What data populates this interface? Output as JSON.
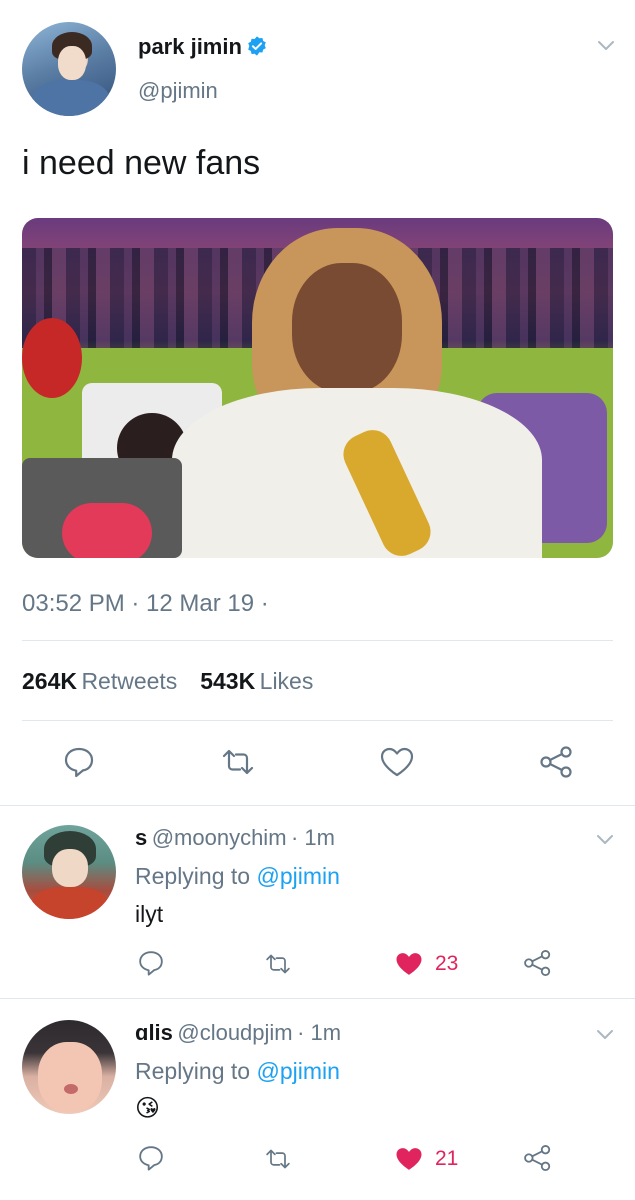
{
  "tweet": {
    "display_name": "park jimin",
    "handle": "@pjimin",
    "text": "i need new fans",
    "timestamp": "03:52 PM · 12 Mar 19 ·",
    "retweets_count": "264K",
    "retweets_label": "Retweets",
    "likes_count": "543K",
    "likes_label": "Likes"
  },
  "actions": {
    "icons": [
      "reply-icon",
      "retweet-icon",
      "like-icon",
      "share-icon"
    ]
  },
  "replies": [
    {
      "display_name": "s",
      "handle": "@moonychim",
      "time": "· 1m",
      "replying_prefix": "Replying to",
      "replying_to": "@pjimin",
      "text": "ilyt",
      "likes": "23"
    },
    {
      "display_name": "ɑlis",
      "handle": "@cloudpjim",
      "time": "· 1m",
      "replying_prefix": "Replying to",
      "replying_to": "@pjimin",
      "text": "😘",
      "likes": "21"
    }
  ],
  "colors": {
    "text": "#14171a",
    "secondary": "#657786",
    "accent": "#1da1f2",
    "like": "#e0245e",
    "divider": "#e1e8ed"
  }
}
